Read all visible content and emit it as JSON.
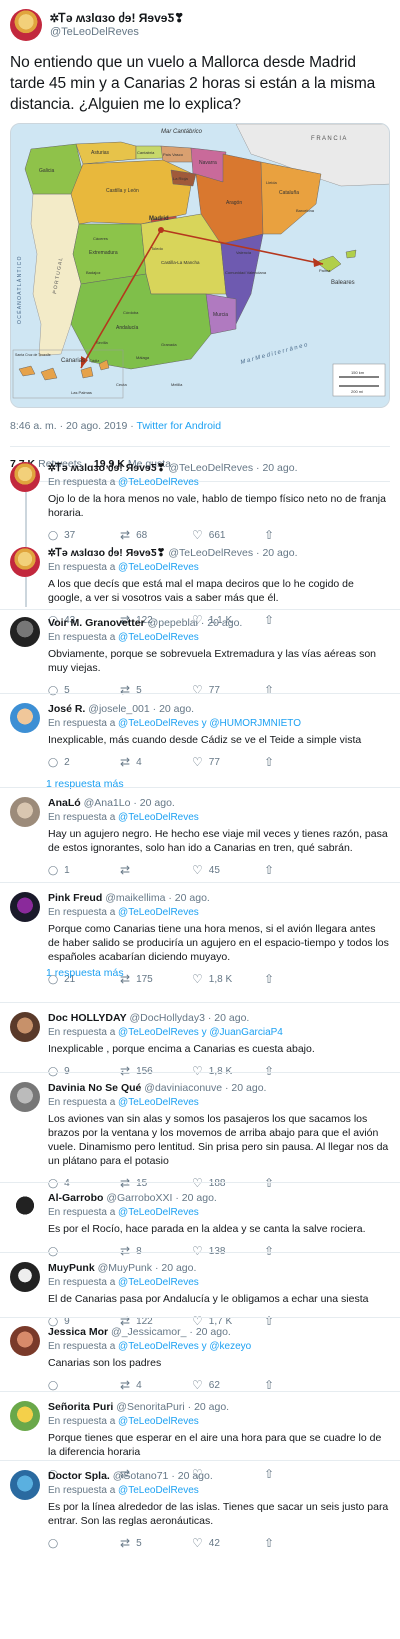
{
  "main": {
    "display_name": "✲Ꭲә ʍɜlɑɜo ძɘ! ЯɘvɘƼ❣",
    "handle": "@TeLeoDelReves",
    "text": "No entiendo que un vuelo a Mallorca desde Madrid tarde 45 min y a Canarias 2 horas si están a la misma distancia. ¿Alguien me lo explica?",
    "time": "8:46 a. m. · 20 ago. 2019 · ",
    "source": "Twitter for Android",
    "retweets_count": "7,7 K",
    "retweets_label": "Retweets",
    "likes_count": "19,9 K",
    "likes_label": "Me gusta"
  },
  "map": {
    "labels": [
      "Mar Cantábrico",
      "F R A N C I A",
      "O C É A N O   A T L Á N T I C O",
      "P O R T U G A L",
      "M a r   M e d i t e r r á n e o",
      "Baleares",
      "Canarias",
      "Madrid",
      "Galicia",
      "Asturias",
      "Cantabria",
      "País Vasco",
      "Navarra",
      "La Rioja",
      "Aragón",
      "Cataluña",
      "Castilla y León",
      "Extremadura",
      "Castilla-La Mancha",
      "Comunidad Valenciana",
      "Andalucía",
      "Murcia",
      "Ceuta",
      "Melilla",
      "Santa Cruz de Tenerife",
      "Las Palmas",
      "150 km",
      "200 mi",
      "Lleida",
      "Barcelona",
      "Valencia",
      "Sevilla",
      "Granada",
      "Málaga",
      "Cádiz",
      "Córdoba",
      "Toledo",
      "Cáceres",
      "Badajoz",
      "Palma"
    ],
    "colors": {
      "sea": "#cfe6f3",
      "portugal": "#f3ebc8",
      "france": "#eaeaea",
      "arrow": "#b5371d"
    }
  },
  "replies_to_label": "En respuesta a",
  "replies": [
    {
      "name": "✲Ꭲә ʍɜlɑɜo ძɘ! ЯɘvɘƼ❣",
      "handle": "@TeLeoDelReves",
      "date": "· 20 ago.",
      "to": "@TeLeoDelReves",
      "text": "Ojo lo de la hora menos no vale, hablo de tiempo físico neto no de franja horaria.",
      "reply_count": "37",
      "rt_count": "68",
      "like_count": "661"
    },
    {
      "name": "✲Ꭲә ʍɜlɑɜo ძɘ! ЯɘvɘƼ❣",
      "handle": "@TeLeoDelReves",
      "date": "· 20 ago.",
      "to": "@TeLeoDelReves",
      "text": "A los que decís que está mal el mapa deciros que lo he cogido de google, a ver si vosotros vais a saber más que él.",
      "reply_count": "43",
      "rt_count": "122",
      "like_count": "1,1 K"
    },
    {
      "name": "Voir M. Granovetter",
      "handle": "@pepeblai",
      "date": "· 20 ago.",
      "to": "@TeLeoDelReves",
      "text": "Obviamente, porque se sobrevuela Extremadura y las vías aéreas son muy viejas.",
      "reply_count": "5",
      "rt_count": "5",
      "like_count": "77"
    },
    {
      "name": "José R.",
      "handle": "@josele_001",
      "date": "· 20 ago.",
      "to": "@TeLeoDelReves y @HUMORJMNIETO",
      "text": "Inexplicable, más cuando desde Cádiz se ve el Teide a simple vista",
      "reply_count": "2",
      "rt_count": "4",
      "like_count": "77",
      "more": "1 respuesta más"
    },
    {
      "name": "AnaLó",
      "handle": "@Ana1Lo",
      "date": "· 20 ago.",
      "to": "@TeLeoDelReves",
      "text": "Hay un agujero negro. He hecho ese viaje mil veces y tienes razón, pasa de estos ignorantes, solo han ido a Canarias en tren, qué sabrán.",
      "reply_count": "1",
      "rt_count": "",
      "like_count": "45"
    },
    {
      "name": "Pink Freud",
      "handle": "@maikellima",
      "date": "· 20 ago.",
      "to": "@TeLeoDelReves",
      "text": "Porque como Canarias tiene una hora menos, si el avión llegara antes de haber salido se produciría un agujero en el espacio-tiempo y todos los españoles acabarían diciendo muyayo.",
      "reply_count": "21",
      "rt_count": "175",
      "like_count": "1,8 K",
      "more": "1 respuesta más"
    },
    {
      "name": "Doc HOLLYDAY",
      "handle": "@DocHollyday3",
      "date": "· 20 ago.",
      "to": "@TeLeoDelReves y @JuanGarciaP4",
      "text": "Inexplicable , porque encima a Canarias es cuesta abajo.",
      "reply_count": "9",
      "rt_count": "156",
      "like_count": "1,8 K"
    },
    {
      "name": "Davinia No Se Qué",
      "handle": "@daviniaconuve",
      "date": "· 20 ago.",
      "to": "@TeLeoDelReves",
      "text": "Los aviones van sin alas y somos los pasajeros los que sacamos los brazos por la ventana y los movemos de arriba abajo para que el avión vuele. Dinamismo pero lentitud. Sin prisa pero sin pausa. Al llegar nos da un plátano para el potasio",
      "reply_count": "4",
      "rt_count": "15",
      "like_count": "188"
    },
    {
      "name": "Al-Garrobo",
      "handle": "@GarroboXXI",
      "date": "· 20 ago.",
      "to": "@TeLeoDelReves",
      "text": "Es por el Rocío, hace parada en la aldea y se canta la salve rociera.",
      "reply_count": "",
      "rt_count": "8",
      "like_count": "138"
    },
    {
      "name": "MuyPunk",
      "handle": "@MuyPunk",
      "date": "· 20 ago.",
      "to": "@TeLeoDelReves",
      "text": "El de Canarias pasa por Andalucía y le obligamos a echar una siesta",
      "reply_count": "9",
      "rt_count": "122",
      "like_count": "1,7 K"
    },
    {
      "name": "Jessica Mor",
      "handle": "@_Jessicamor_",
      "date": "· 20 ago.",
      "to": "@TeLeoDelReves y @kezeyo",
      "text": "Canarias son los padres",
      "reply_count": "",
      "rt_count": "4",
      "like_count": "62"
    },
    {
      "name": "Señorita Puri",
      "handle": "@SenoritaPuri",
      "date": "· 20 ago.",
      "to": "@TeLeoDelReves",
      "text": "Porque tienes que esperar en el aire una hora para que se cuadre lo de la diferencia horaria",
      "reply_count": "",
      "rt_count": "",
      "like_count": ""
    },
    {
      "name": "Doctor Spla.",
      "handle": "@Sotano71",
      "date": "· 20 ago.",
      "to": "@TeLeoDelReves",
      "text": "Es por la línea alrededor de las islas. Tienes que sacar un seis justo para entrar. Son las reglas aeronáuticas.",
      "reply_count": "",
      "rt_count": "5",
      "like_count": "42"
    }
  ],
  "icons": {
    "reply": "reply-icon",
    "retweet": "retweet-icon",
    "like": "heart-icon",
    "share": "share-icon"
  }
}
